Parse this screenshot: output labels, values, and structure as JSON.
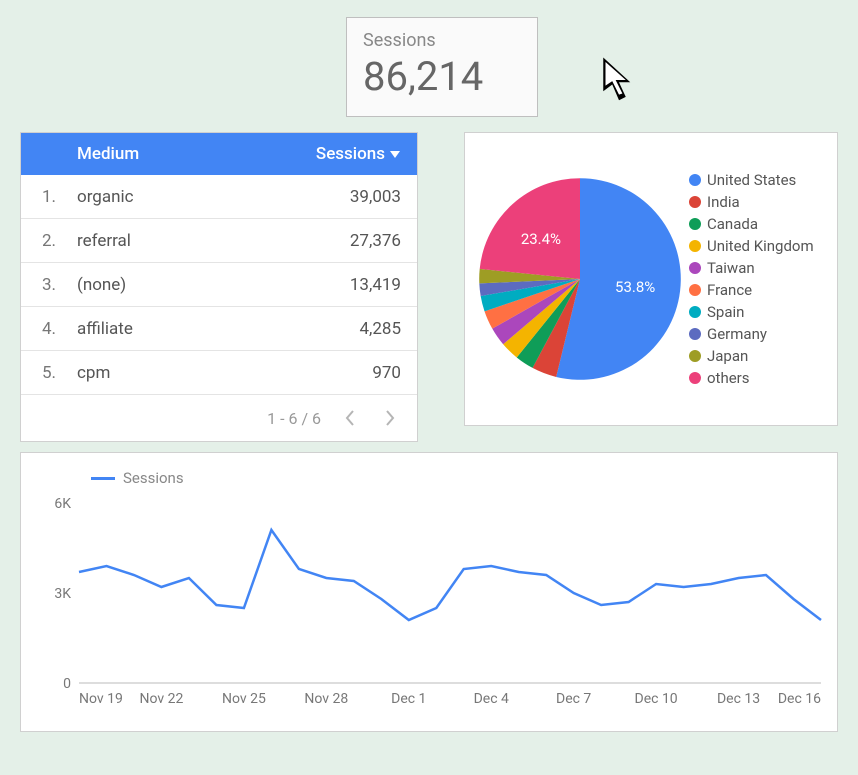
{
  "scorecard": {
    "label": "Sessions",
    "value": "86,214"
  },
  "table": {
    "headers": {
      "medium": "Medium",
      "sessions": "Sessions"
    },
    "sort_desc_on": "sessions",
    "rows": [
      {
        "idx": "1.",
        "medium": "organic",
        "sessions": "39,003"
      },
      {
        "idx": "2.",
        "medium": "referral",
        "sessions": "27,376"
      },
      {
        "idx": "3.",
        "medium": "(none)",
        "sessions": "13,419"
      },
      {
        "idx": "4.",
        "medium": "affiliate",
        "sessions": "4,285"
      },
      {
        "idx": "5.",
        "medium": "cpm",
        "sessions": "970"
      }
    ],
    "footer": {
      "range": "1 - 6 / 6"
    }
  },
  "pie": {
    "legend": [
      {
        "label": "United States",
        "color": "#4285f4"
      },
      {
        "label": "India",
        "color": "#db4437"
      },
      {
        "label": "Canada",
        "color": "#0f9d58"
      },
      {
        "label": "United Kingdom",
        "color": "#f4b400"
      },
      {
        "label": "Taiwan",
        "color": "#ab47bc"
      },
      {
        "label": "France",
        "color": "#ff7043"
      },
      {
        "label": "Spain",
        "color": "#00acc1"
      },
      {
        "label": "Germany",
        "color": "#5c6bc0"
      },
      {
        "label": "Japan",
        "color": "#9e9d24"
      },
      {
        "label": "others",
        "color": "#ec407a"
      }
    ],
    "visible_labels": {
      "main": "53.8%",
      "others": "23.4%"
    }
  },
  "line": {
    "legend_label": "Sessions"
  },
  "chart_data": [
    {
      "type": "pie",
      "title": "",
      "series": [
        {
          "name": "United States",
          "value": 53.8,
          "color": "#4285f4"
        },
        {
          "name": "India",
          "value": 4,
          "color": "#db4437"
        },
        {
          "name": "Canada",
          "value": 3,
          "color": "#0f9d58"
        },
        {
          "name": "United Kingdom",
          "value": 3,
          "color": "#f4b400"
        },
        {
          "name": "Taiwan",
          "value": 3,
          "color": "#ab47bc"
        },
        {
          "name": "France",
          "value": 3,
          "color": "#ff7043"
        },
        {
          "name": "Spain",
          "value": 2.5,
          "color": "#00acc1"
        },
        {
          "name": "Germany",
          "value": 2,
          "color": "#5c6bc0"
        },
        {
          "name": "Japan",
          "value": 2.3,
          "color": "#9e9d24"
        },
        {
          "name": "others",
          "value": 23.4,
          "color": "#ec407a"
        }
      ],
      "visible_value_labels": [
        "53.8%",
        "23.4%"
      ]
    },
    {
      "type": "line",
      "title": "",
      "xlabel": "",
      "ylabel": "",
      "ylim": [
        0,
        6000
      ],
      "y_ticks": [
        "0",
        "3K",
        "6K"
      ],
      "x_ticks": [
        "Nov 19",
        "Nov 22",
        "Nov 25",
        "Nov 28",
        "Dec 1",
        "Dec 4",
        "Dec 7",
        "Dec 10",
        "Dec 13",
        "Dec 16"
      ],
      "series": [
        {
          "name": "Sessions",
          "color": "#4285f4",
          "x": [
            "Nov 19",
            "Nov 20",
            "Nov 21",
            "Nov 22",
            "Nov 23",
            "Nov 24",
            "Nov 25",
            "Nov 26",
            "Nov 27",
            "Nov 28",
            "Nov 29",
            "Nov 30",
            "Dec 1",
            "Dec 2",
            "Dec 3",
            "Dec 4",
            "Dec 5",
            "Dec 6",
            "Dec 7",
            "Dec 8",
            "Dec 9",
            "Dec 10",
            "Dec 11",
            "Dec 12",
            "Dec 13",
            "Dec 14",
            "Dec 15",
            "Dec 16"
          ],
          "values": [
            3700,
            3900,
            3600,
            3200,
            3500,
            2600,
            2500,
            5100,
            3800,
            3500,
            3400,
            2800,
            2100,
            2500,
            3800,
            3900,
            3700,
            3600,
            3000,
            2600,
            2700,
            3300,
            3200,
            3300,
            3500,
            3600,
            2800,
            2100
          ]
        }
      ]
    }
  ]
}
